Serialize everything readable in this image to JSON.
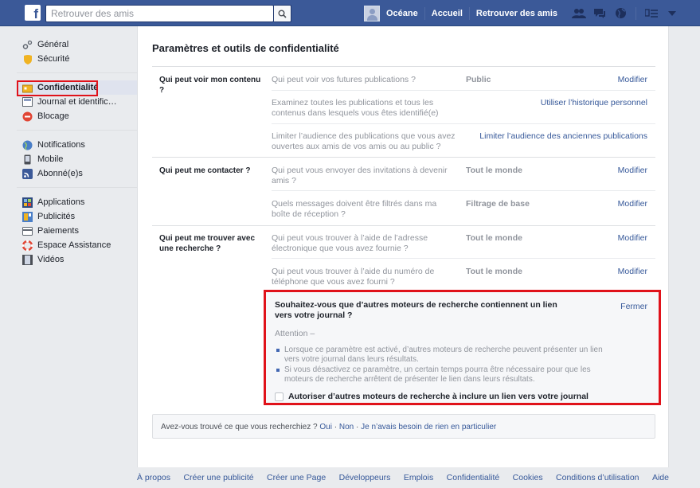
{
  "topbar": {
    "search_placeholder": "Retrouver des amis",
    "user_name": "Océane",
    "home": "Accueil",
    "find_friends": "Retrouver des amis",
    "colors": {
      "bar": "#3b5998"
    }
  },
  "sidebar": {
    "groups": [
      [
        {
          "label": "Général",
          "icon": "gears-icon"
        },
        {
          "label": "Sécurité",
          "icon": "shield-icon"
        }
      ],
      [
        {
          "label": "Confidentialité",
          "icon": "lock-icon",
          "active": true
        },
        {
          "label": "Journal et identific…",
          "icon": "timeline-icon"
        },
        {
          "label": "Blocage",
          "icon": "block-icon"
        }
      ],
      [
        {
          "label": "Notifications",
          "icon": "globe-icon"
        },
        {
          "label": "Mobile",
          "icon": "mobile-icon"
        },
        {
          "label": "Abonné(e)s",
          "icon": "rss-icon"
        }
      ],
      [
        {
          "label": "Applications",
          "icon": "apps-icon"
        },
        {
          "label": "Publicités",
          "icon": "ads-icon"
        },
        {
          "label": "Paiements",
          "icon": "card-icon"
        },
        {
          "label": "Espace Assistance",
          "icon": "lifebuoy-icon"
        },
        {
          "label": "Vidéos",
          "icon": "film-icon"
        }
      ]
    ]
  },
  "main": {
    "title": "Paramètres et outils de confidentialité",
    "sections": {
      "content": {
        "label": "Qui peut voir mon contenu ?",
        "rows": [
          {
            "q": "Qui peut voir vos futures publications ?",
            "value": "Public",
            "action": "Modifier"
          },
          {
            "q": "Examinez toutes les publications et tous les contenus dans lesquels vous êtes identifié(e)",
            "value": "",
            "action": "Utiliser l’historique personnel"
          },
          {
            "q": "Limiter l’audience des publications que vous avez ouvertes aux amis de vos amis ou au public ?",
            "value": "",
            "action": "Limiter l’audience des anciennes publications"
          }
        ]
      },
      "contact": {
        "label": "Qui peut me contacter ?",
        "rows": [
          {
            "q": "Qui peut vous envoyer des invitations à devenir amis ?",
            "value": "Tout le monde",
            "action": "Modifier"
          },
          {
            "q": "Quels messages doivent être filtrés dans ma boîte de réception ?",
            "value": "Filtrage de base",
            "action": "Modifier"
          }
        ]
      },
      "lookup": {
        "label": "Qui peut me trouver avec une recherche ?",
        "rows": [
          {
            "q": "Qui peut vous trouver à l’aide de l’adresse électronique que vous avez fournie ?",
            "value": "Tout le monde",
            "action": "Modifier"
          },
          {
            "q": "Qui peut vous trouver à l’aide du numéro de téléphone que vous avez fourni ?",
            "value": "Tout le monde",
            "action": "Modifier"
          }
        ]
      }
    },
    "search_engine": {
      "title": "Souhaitez-vous que d’autres moteurs de recherche contiennent un lien vers votre journal ?",
      "close": "Fermer",
      "attention": "Attention –",
      "bullets": [
        "Lorsque ce paramètre est activé, d’autres moteurs de recherche peuvent présenter un lien vers votre journal dans leurs résultats.",
        "Si vous désactivez ce paramètre, un certain temps pourra être nécessaire pour que les moteurs de recherche arrêtent de présenter le lien dans leurs résultats."
      ],
      "checkbox_label": "Autoriser d’autres moteurs de recherche à inclure un lien vers votre journal",
      "checked": false
    },
    "feedback": {
      "question": "Avez-vous trouvé ce que vous recherchiez ?",
      "yes": "Oui",
      "no": "Non",
      "nothing": "Je n’avais besoin de rien en particulier",
      "sep": "·"
    }
  },
  "footer": [
    "À propos",
    "Créer une publicité",
    "Créer une Page",
    "Développeurs",
    "Emplois",
    "Confidentialité",
    "Cookies",
    "Conditions d’utilisation",
    "Aide"
  ]
}
